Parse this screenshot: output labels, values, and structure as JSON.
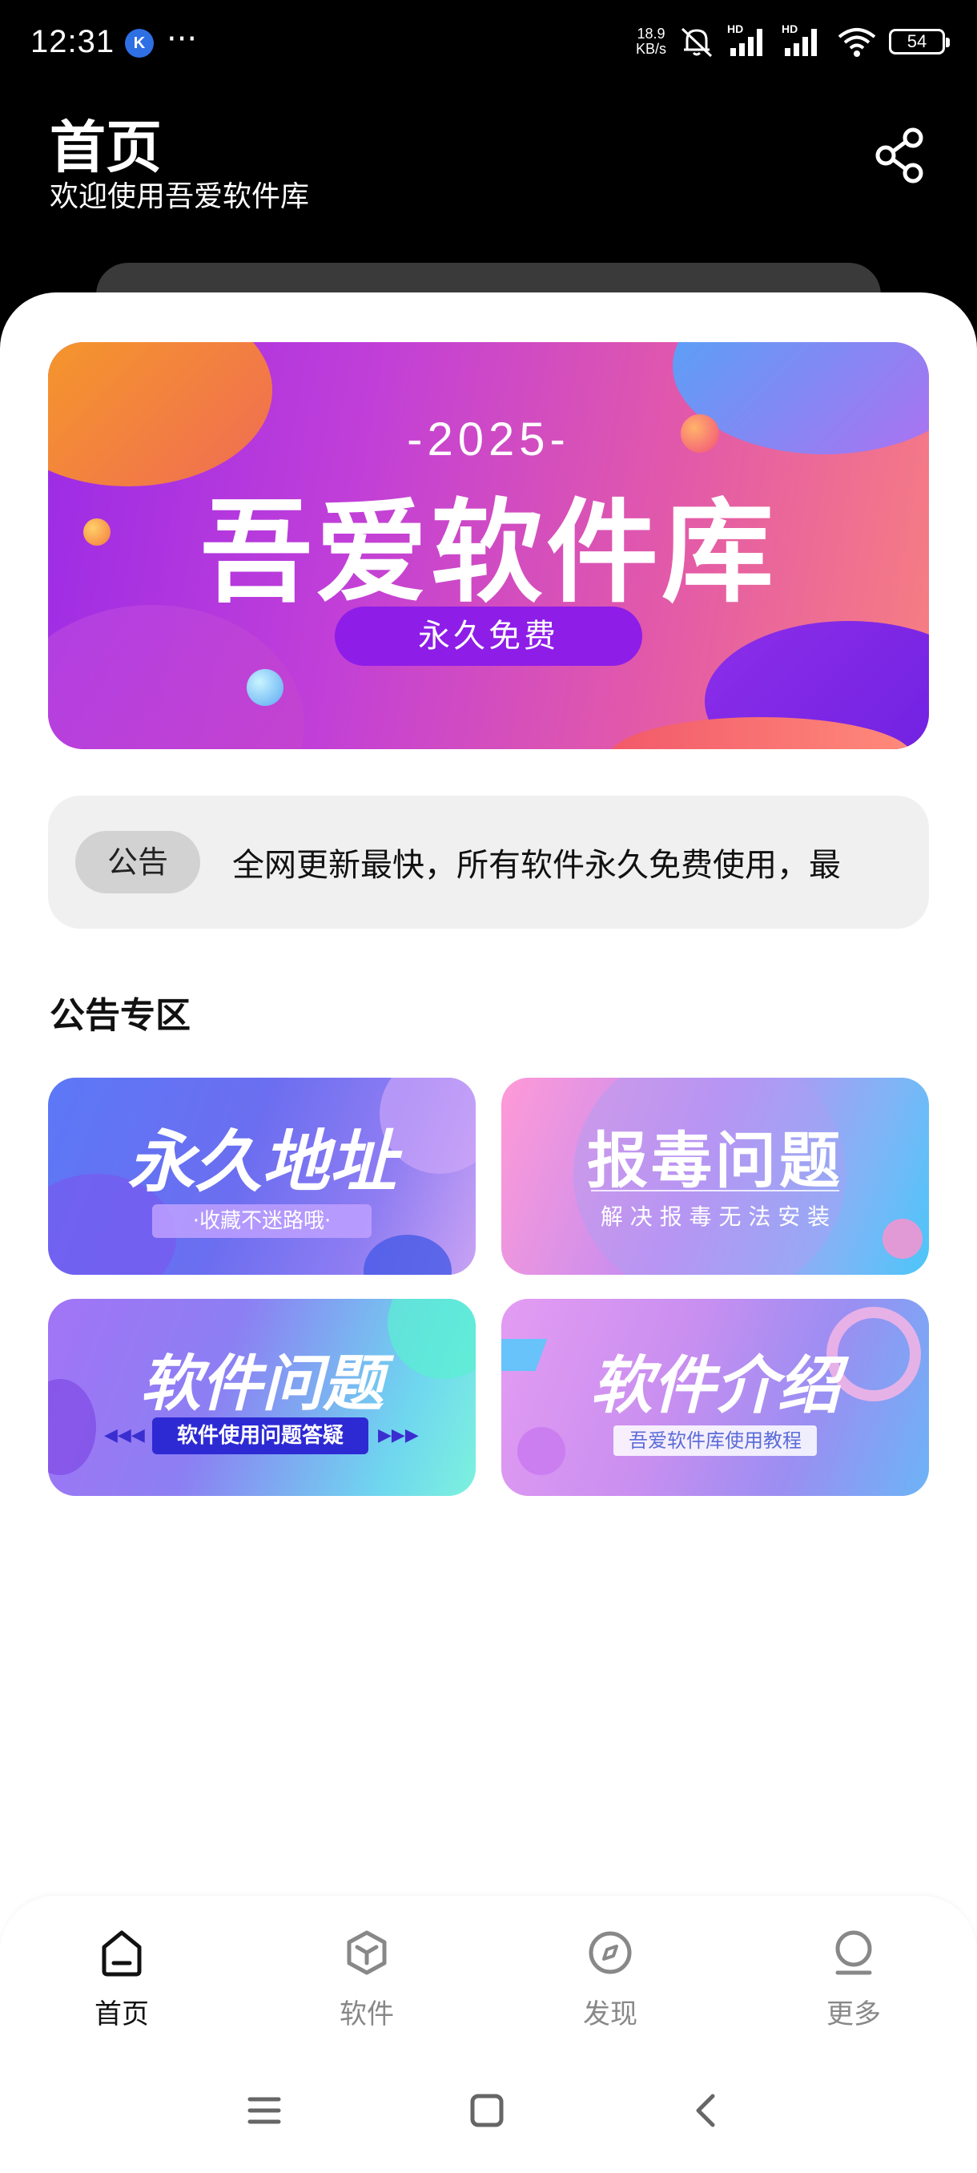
{
  "status_bar": {
    "time": "12:31",
    "app_badge": "K",
    "more": "···",
    "net_speed_value": "18.9",
    "net_speed_unit": "KB/s",
    "signal_label_1": "HD",
    "signal_label_2": "HD",
    "battery": "54"
  },
  "header": {
    "title": "首页",
    "subtitle": "欢迎使用吾爱软件库"
  },
  "banner": {
    "year": "-2025-",
    "title": "吾爱软件库",
    "tag": "永久免费"
  },
  "notice": {
    "tag": "公告",
    "text": "全网更新最快，所有软件永久免费使用，最"
  },
  "section": {
    "title": "公告专区"
  },
  "cards": [
    {
      "title": "永久地址",
      "subtitle": "·收藏不迷路哦·"
    },
    {
      "title": "报毒问题",
      "subtitle": "解 决 报 毒 无 法 安 装"
    },
    {
      "title": "软件问题",
      "subtitle": "软件使用问题答疑"
    },
    {
      "title": "软件介绍",
      "subtitle": "吾爱软件库使用教程"
    }
  ],
  "bottom_nav": {
    "items": [
      {
        "label": "首页",
        "icon": "home-icon",
        "active": true
      },
      {
        "label": "软件",
        "icon": "cube-icon",
        "active": false
      },
      {
        "label": "发现",
        "icon": "compass-icon",
        "active": false
      },
      {
        "label": "更多",
        "icon": "user-icon",
        "active": false
      }
    ]
  },
  "system_nav": {
    "icons": [
      "menu-icon",
      "home-square-icon",
      "back-icon"
    ]
  }
}
